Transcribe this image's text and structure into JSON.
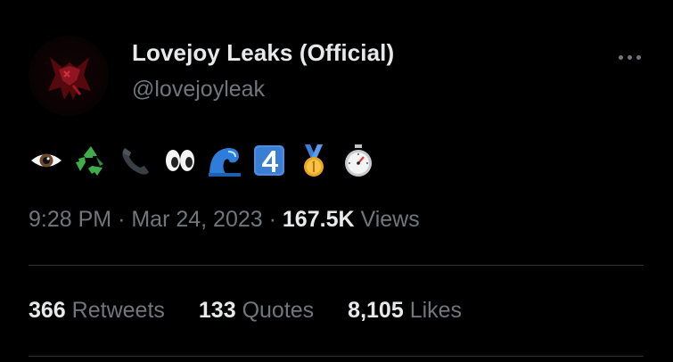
{
  "author": {
    "display_name": "Lovejoy Leaks (Official)",
    "handle": "@lovejoyleak",
    "avatar_icon": "red-bat-logo-icon"
  },
  "more_icon": "ellipsis-icon",
  "tweet": {
    "emojis": [
      "eye-emoji",
      "recycle-emoji",
      "telephone-emoji",
      "eyes-emoji",
      "wave-emoji",
      "keycap-4-emoji",
      "first-place-medal-emoji",
      "stopwatch-emoji"
    ],
    "time": "9:28 PM",
    "separator": "·",
    "date": "Mar 24, 2023",
    "views_count": "167.5K",
    "views_label": "Views"
  },
  "stats": {
    "retweets_count": "366",
    "retweets_label": "Retweets",
    "quotes_count": "133",
    "quotes_label": "Quotes",
    "likes_count": "8,105",
    "likes_label": "Likes"
  },
  "colors": {
    "background": "#000000",
    "primary_text": "#e7e9ea",
    "secondary_text": "#71767b",
    "divider": "#2f3336"
  }
}
